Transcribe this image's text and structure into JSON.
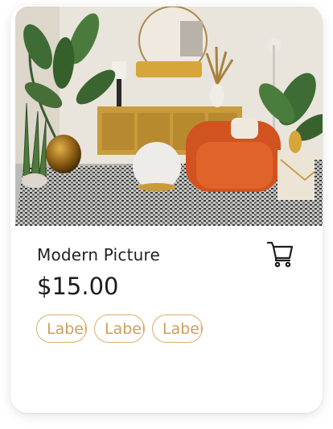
{
  "product": {
    "image_description_icon": "living-room-photo",
    "title": "Modern Picture",
    "price": "$15.00",
    "cart_icon": "cart-icon",
    "labels": [
      "Label",
      "Label",
      "Label"
    ]
  },
  "colors": {
    "label_border": "#d9ae6a",
    "label_text": "#c9a060",
    "text": "#222222"
  }
}
